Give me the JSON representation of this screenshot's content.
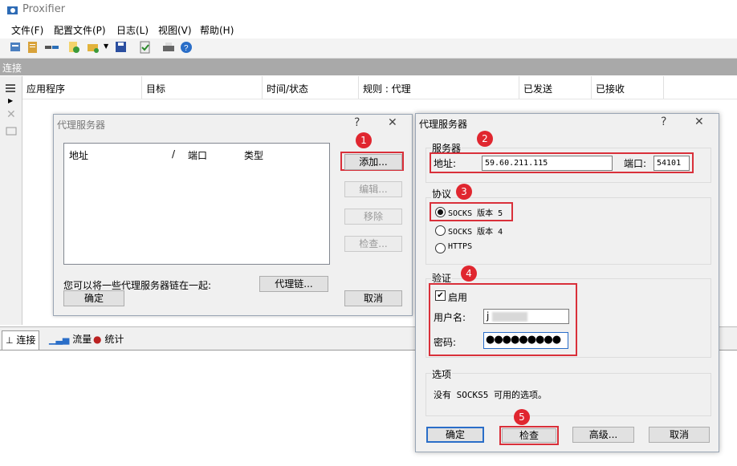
{
  "app": {
    "title": "Proxifier"
  },
  "menu": [
    "文件(F)",
    "配置文件(P)",
    "日志(L)",
    "视图(V)",
    "帮助(H)"
  ],
  "toolbar_icons": [
    "new-profile-icon",
    "notes-icon",
    "rules-icon",
    "add-icon",
    "open-icon",
    "save-icon",
    "check-icon",
    "print-icon",
    "help-icon"
  ],
  "section": {
    "title": "连接"
  },
  "columns": [
    "应用程序",
    "目标",
    "时间/状态",
    "规则 : 代理",
    "已发送",
    "已接收"
  ],
  "bottom_tabs": [
    "连接",
    "流量",
    "统计"
  ],
  "dialog1": {
    "title": "代理服务器",
    "help": "?",
    "close": "✕",
    "list_headers": [
      "地址",
      "/",
      "端口",
      "类型"
    ],
    "buttons": {
      "add": "添加...",
      "edit": "编辑...",
      "remove": "移除",
      "check": "检查..."
    },
    "chain_text": "您可以将一些代理服务器链在一起:",
    "chain_button": "代理链...",
    "ok": "确定",
    "cancel": "取消"
  },
  "dialog2": {
    "title": "代理服务器",
    "help": "?",
    "close": "✕",
    "server_group": "服务器",
    "address_label": "地址:",
    "address_value": "59.60.211.115",
    "port_label": "端口:",
    "port_value": "54101",
    "protocol_group": "协议",
    "protocols": [
      "SOCKS 版本 5",
      "SOCKS 版本 4",
      "HTTPS"
    ],
    "selected_protocol": "SOCKS 版本 5",
    "auth_group": "验证",
    "enable_label": "启用",
    "enable_checked": true,
    "username_label": "用户名:",
    "username_value": "j",
    "password_label": "密码:",
    "password_value": "●●●●●●●●●",
    "options_group": "选项",
    "options_text": "没有 SOCKS5 可用的选项。",
    "buttons": {
      "ok": "确定",
      "check": "检查",
      "advanced": "高级...",
      "cancel": "取消"
    }
  },
  "badges": [
    "1",
    "2",
    "3",
    "4",
    "5"
  ],
  "colors": {
    "highlight": "#d9303a",
    "badge": "#e0262f",
    "header_bar": "#a9a9a9"
  }
}
